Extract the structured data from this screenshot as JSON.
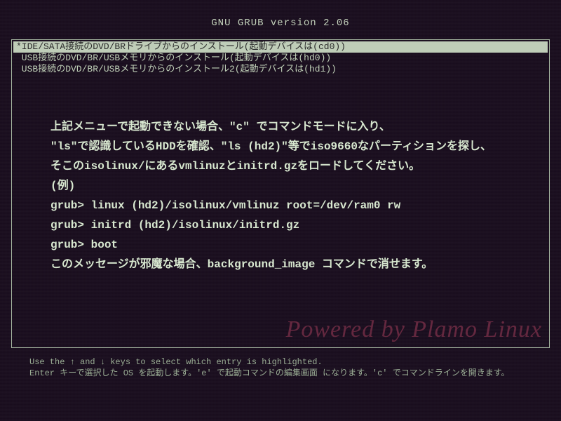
{
  "header": {
    "title": "GNU GRUB  version 2.06"
  },
  "menu": {
    "items": [
      {
        "label": "*IDE/SATA接続のDVD/BRドライブからのインストール(起動デバイスは(cd0))",
        "selected": true
      },
      {
        "label": " USB接続のDVD/BR/USBメモリからのインストール(起動デバイスは(hd0))",
        "selected": false
      },
      {
        "label": " USB接続のDVD/BR/USBメモリからのインストール2(起動デバイスは(hd1))",
        "selected": false
      }
    ]
  },
  "body": {
    "lines": [
      "上記メニューで起動できない場合、\"c\" でコマンドモードに入り、",
      "\"ls\"で認識しているHDDを確認、\"ls (hd2)\"等でiso9660なパーティションを探し、",
      "そこのisolinux/にあるvmlinuzとinitrd.gzをロードしてください。",
      "",
      "(例)",
      "grub> linux (hd2)/isolinux/vmlinuz root=/dev/ram0 rw",
      "grub> initrd (hd2)/isolinux/initrd.gz",
      "grub> boot",
      "",
      "このメッセージが邪魔な場合、background_image コマンドで消せます。"
    ]
  },
  "watermark": "Powered by Plamo Linux",
  "footer": {
    "line1": "Use the ↑ and ↓ keys to select which entry is highlighted.",
    "line2": "Enter キーで選択した OS を起動します。'e' で起動コマンドの編集画面 になります。'c' でコマンドラインを開きます。"
  }
}
